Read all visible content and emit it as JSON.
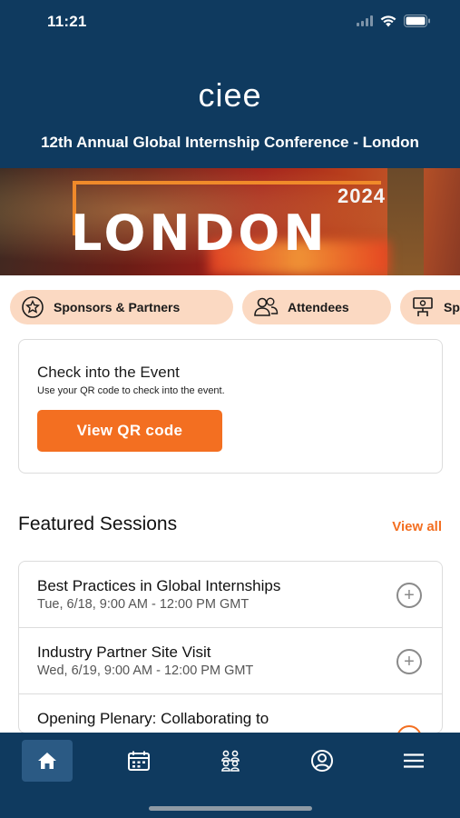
{
  "status_bar": {
    "time": "11:21"
  },
  "header": {
    "logo_text": "ciee",
    "conference_title": "12th Annual Global Internship Conference - London"
  },
  "banner": {
    "year": "2024",
    "city": "LONDON"
  },
  "chips": [
    {
      "label": "Sponsors & Partners",
      "icon": "star-badge-icon"
    },
    {
      "label": "Attendees",
      "icon": "people-icon"
    },
    {
      "label": "Sp",
      "icon": "speaker-icon"
    }
  ],
  "checkin": {
    "title": "Check into the Event",
    "subtitle": "Use your QR code to check into the event.",
    "button_label": "View QR code"
  },
  "featured": {
    "title": "Featured Sessions",
    "view_all": "View all",
    "sessions": [
      {
        "name": "Best Practices in Global Internships",
        "time": "Tue, 6/18, 9:00 AM - 12:00 PM GMT"
      },
      {
        "name": "Industry Partner Site Visit",
        "time": "Wed, 6/19, 9:00 AM - 12:00 PM GMT"
      },
      {
        "name": "Opening Plenary: Collaborating to",
        "time": ""
      }
    ]
  },
  "tabbar": {
    "items": [
      {
        "icon": "home-icon",
        "active": true
      },
      {
        "icon": "calendar-icon",
        "active": false
      },
      {
        "icon": "people-group-icon",
        "active": false
      },
      {
        "icon": "profile-icon",
        "active": false
      },
      {
        "icon": "menu-icon",
        "active": false
      }
    ]
  },
  "colors": {
    "brand_navy": "#0f3a5f",
    "accent_orange": "#f36f21",
    "chip_bg": "#fbd9c2"
  }
}
